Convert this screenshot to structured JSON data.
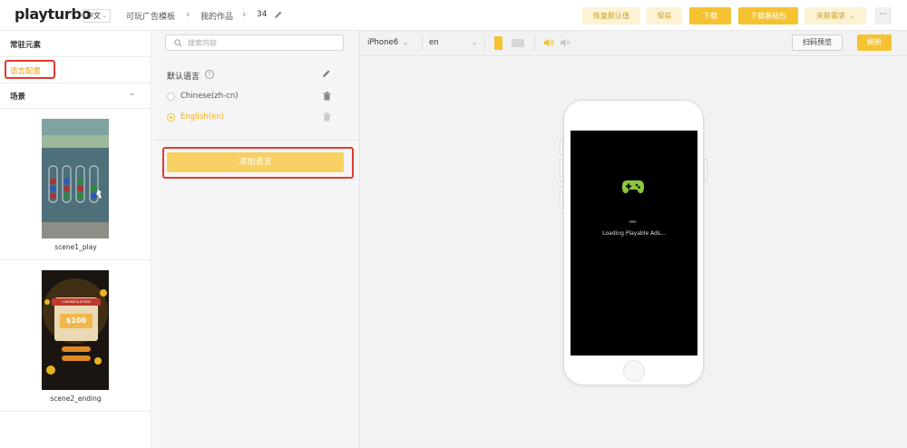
{
  "header": {
    "logo": "playturbo",
    "ui_language": "中文",
    "breadcrumb": [
      "可玩广告模板",
      "我的作品",
      "34"
    ],
    "buttons": {
      "restore_default": "恢复默认值",
      "save": "保存",
      "download": "下载",
      "download_base": "下载基础包",
      "related_needs": "关联需求",
      "more": "···"
    }
  },
  "sidebar": {
    "resident_elements": "常驻元素",
    "language_config": "语言配置",
    "scenes_title": "场景",
    "scenes": [
      {
        "label": "scene1_play"
      },
      {
        "label": "scene2_ending"
      }
    ],
    "ending_thumb": {
      "banner": "CONGRATULATIONS",
      "amount": "$100"
    }
  },
  "language_panel": {
    "search_placeholder": "搜索内容",
    "default_language_label": "默认语言",
    "help_glyph": "?",
    "languages": [
      {
        "name": "Chinese(zh-cn)",
        "selected": false
      },
      {
        "name": "English(en)",
        "selected": true
      }
    ],
    "add_language_button": "添加语言"
  },
  "preview": {
    "device": "iPhone6",
    "locale": "en",
    "scan_preview": "扫码预览",
    "refresh": "刷新",
    "loading_text": "Loading Playable Ads..."
  },
  "colors": {
    "accent": "#f5c231",
    "accent_light": "#fdf2d4",
    "highlight_box": "#e03b2f",
    "game_icon": "#8dc63f"
  }
}
